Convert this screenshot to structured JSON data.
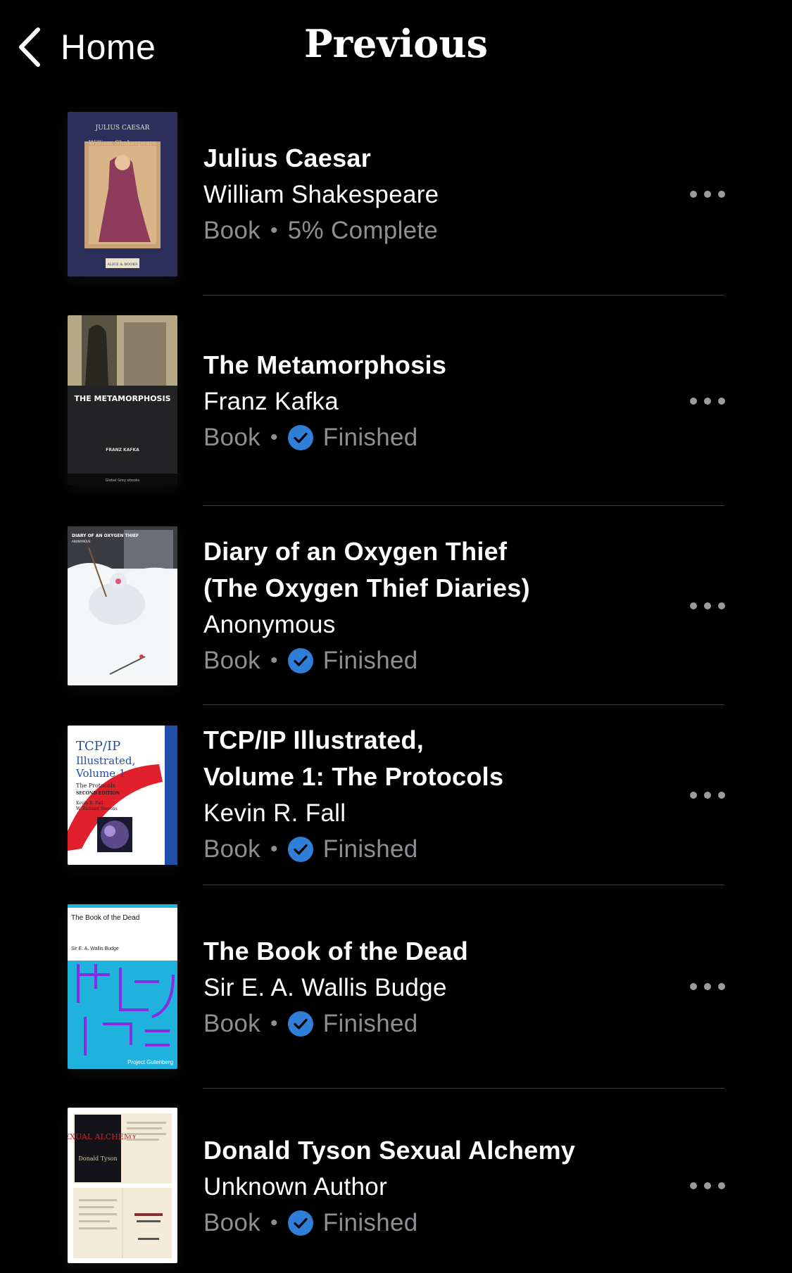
{
  "nav": {
    "back_label": "Home",
    "title": "Previous"
  },
  "books": [
    {
      "title_lines": [
        "Julius Caesar"
      ],
      "author": "William Shakespeare",
      "kind": "Book",
      "status": "5% Complete",
      "finished": false,
      "cover": {
        "top_text": "JULIUS CAESAR",
        "sub_text": "William Shakespeare",
        "publisher": "ALICE & BOOKS"
      }
    },
    {
      "title_lines": [
        "The Metamorphosis"
      ],
      "author": "Franz Kafka",
      "kind": "Book",
      "status": "Finished",
      "finished": true,
      "cover": {
        "top_text": "THE METAMORPHOSIS",
        "sub_text": "FRANZ KAFKA",
        "publisher": "Global Grey ebooks"
      }
    },
    {
      "title_lines": [
        "Diary of an Oxygen Thief",
        "(The Oxygen Thief Diaries)"
      ],
      "author": "Anonymous",
      "kind": "Book",
      "status": "Finished",
      "finished": true,
      "cover": {
        "top_text": "DIARY OF AN OXYGEN THIEF",
        "sub_text": "ANONYMOUS"
      }
    },
    {
      "title_lines": [
        "TCP/IP Illustrated,",
        "Volume 1: The Protocols"
      ],
      "author": "Kevin R. Fall",
      "kind": "Book",
      "status": "Finished",
      "finished": true,
      "cover": {
        "top_text": "TCP/IP",
        "line2": "Illustrated,",
        "line3": "Volume 1",
        "sub_text": "The Protocols",
        "edition": "SECOND EDITION",
        "authors": "Kevin R. Fall",
        "authors2": "W. Richard Stevens"
      }
    },
    {
      "title_lines": [
        "The Book of the Dead"
      ],
      "author": "Sir E. A. Wallis Budge",
      "kind": "Book",
      "status": "Finished",
      "finished": true,
      "cover": {
        "top_text": "The Book of the Dead",
        "sub_text": "Sir E. A. Wallis Budge",
        "publisher": "Project Gutenberg"
      }
    },
    {
      "title_lines": [
        "Donald Tyson Sexual Alchemy"
      ],
      "author": "Unknown Author",
      "kind": "Book",
      "status": "Finished",
      "finished": true,
      "cover": {
        "top_text": "SEXUAL ALCHEMY",
        "sub_text": "Donald Tyson"
      }
    }
  ],
  "colors": {
    "background": "#000000",
    "secondary_text": "#8e8e93",
    "check_blue": "#2f7fd8",
    "divider": "#38383a"
  }
}
